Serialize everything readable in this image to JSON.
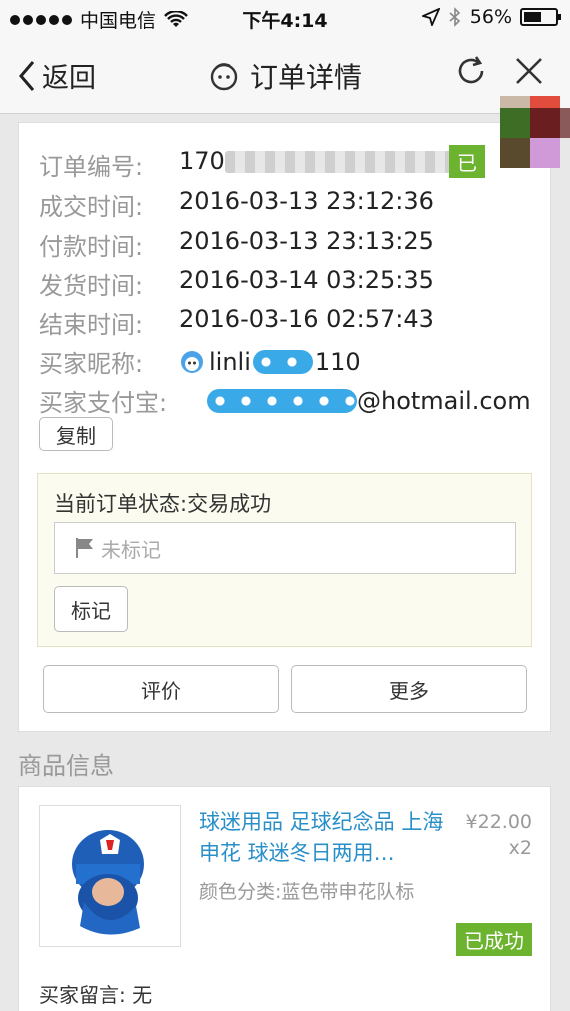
{
  "statusbar": {
    "carrier": "中国电信",
    "time": "下午4:14",
    "battery": "56%",
    "battery_level": 0.56
  },
  "navbar": {
    "back_label": "返回",
    "title": "订单详情"
  },
  "order": {
    "number_label": "订单编号:",
    "number_value": "170",
    "deal_time_label": "成交时间:",
    "deal_time": "2016-03-13 23:12:36",
    "pay_time_label": "付款时间:",
    "pay_time": "2016-03-13 23:13:25",
    "ship_time_label": "发货时间:",
    "ship_time": "2016-03-14 03:25:35",
    "end_time_label": "结束时间:",
    "end_time": "2016-03-16 02:57:43",
    "buyer_nick_label": "买家昵称:",
    "buyer_nick_prefix": "linli",
    "buyer_nick_suffix": "110",
    "buyer_alipay_label": "买家支付宝:",
    "buyer_alipay_suffix": "@hotmail.com",
    "copy_button": "复制",
    "status_tag": "已"
  },
  "status_box": {
    "status_text": "当前订单状态:交易成功",
    "mark_placeholder": "未标记",
    "mark_button": "标记"
  },
  "actions": {
    "rate_button": "评价",
    "more_button": "更多"
  },
  "product_section": {
    "title": "商品信息",
    "product": {
      "name": "球迷用品 足球纪念品 上海申花 球迷冬日两用…",
      "price": "¥22.00",
      "quantity": "x2",
      "spec": "颜色分类:蓝色带申花队标",
      "status": "已成功"
    },
    "buyer_message": "买家留言: 无"
  },
  "colors": {
    "accent_blue": "#2a8fc9",
    "success_green": "#6cb32f"
  }
}
